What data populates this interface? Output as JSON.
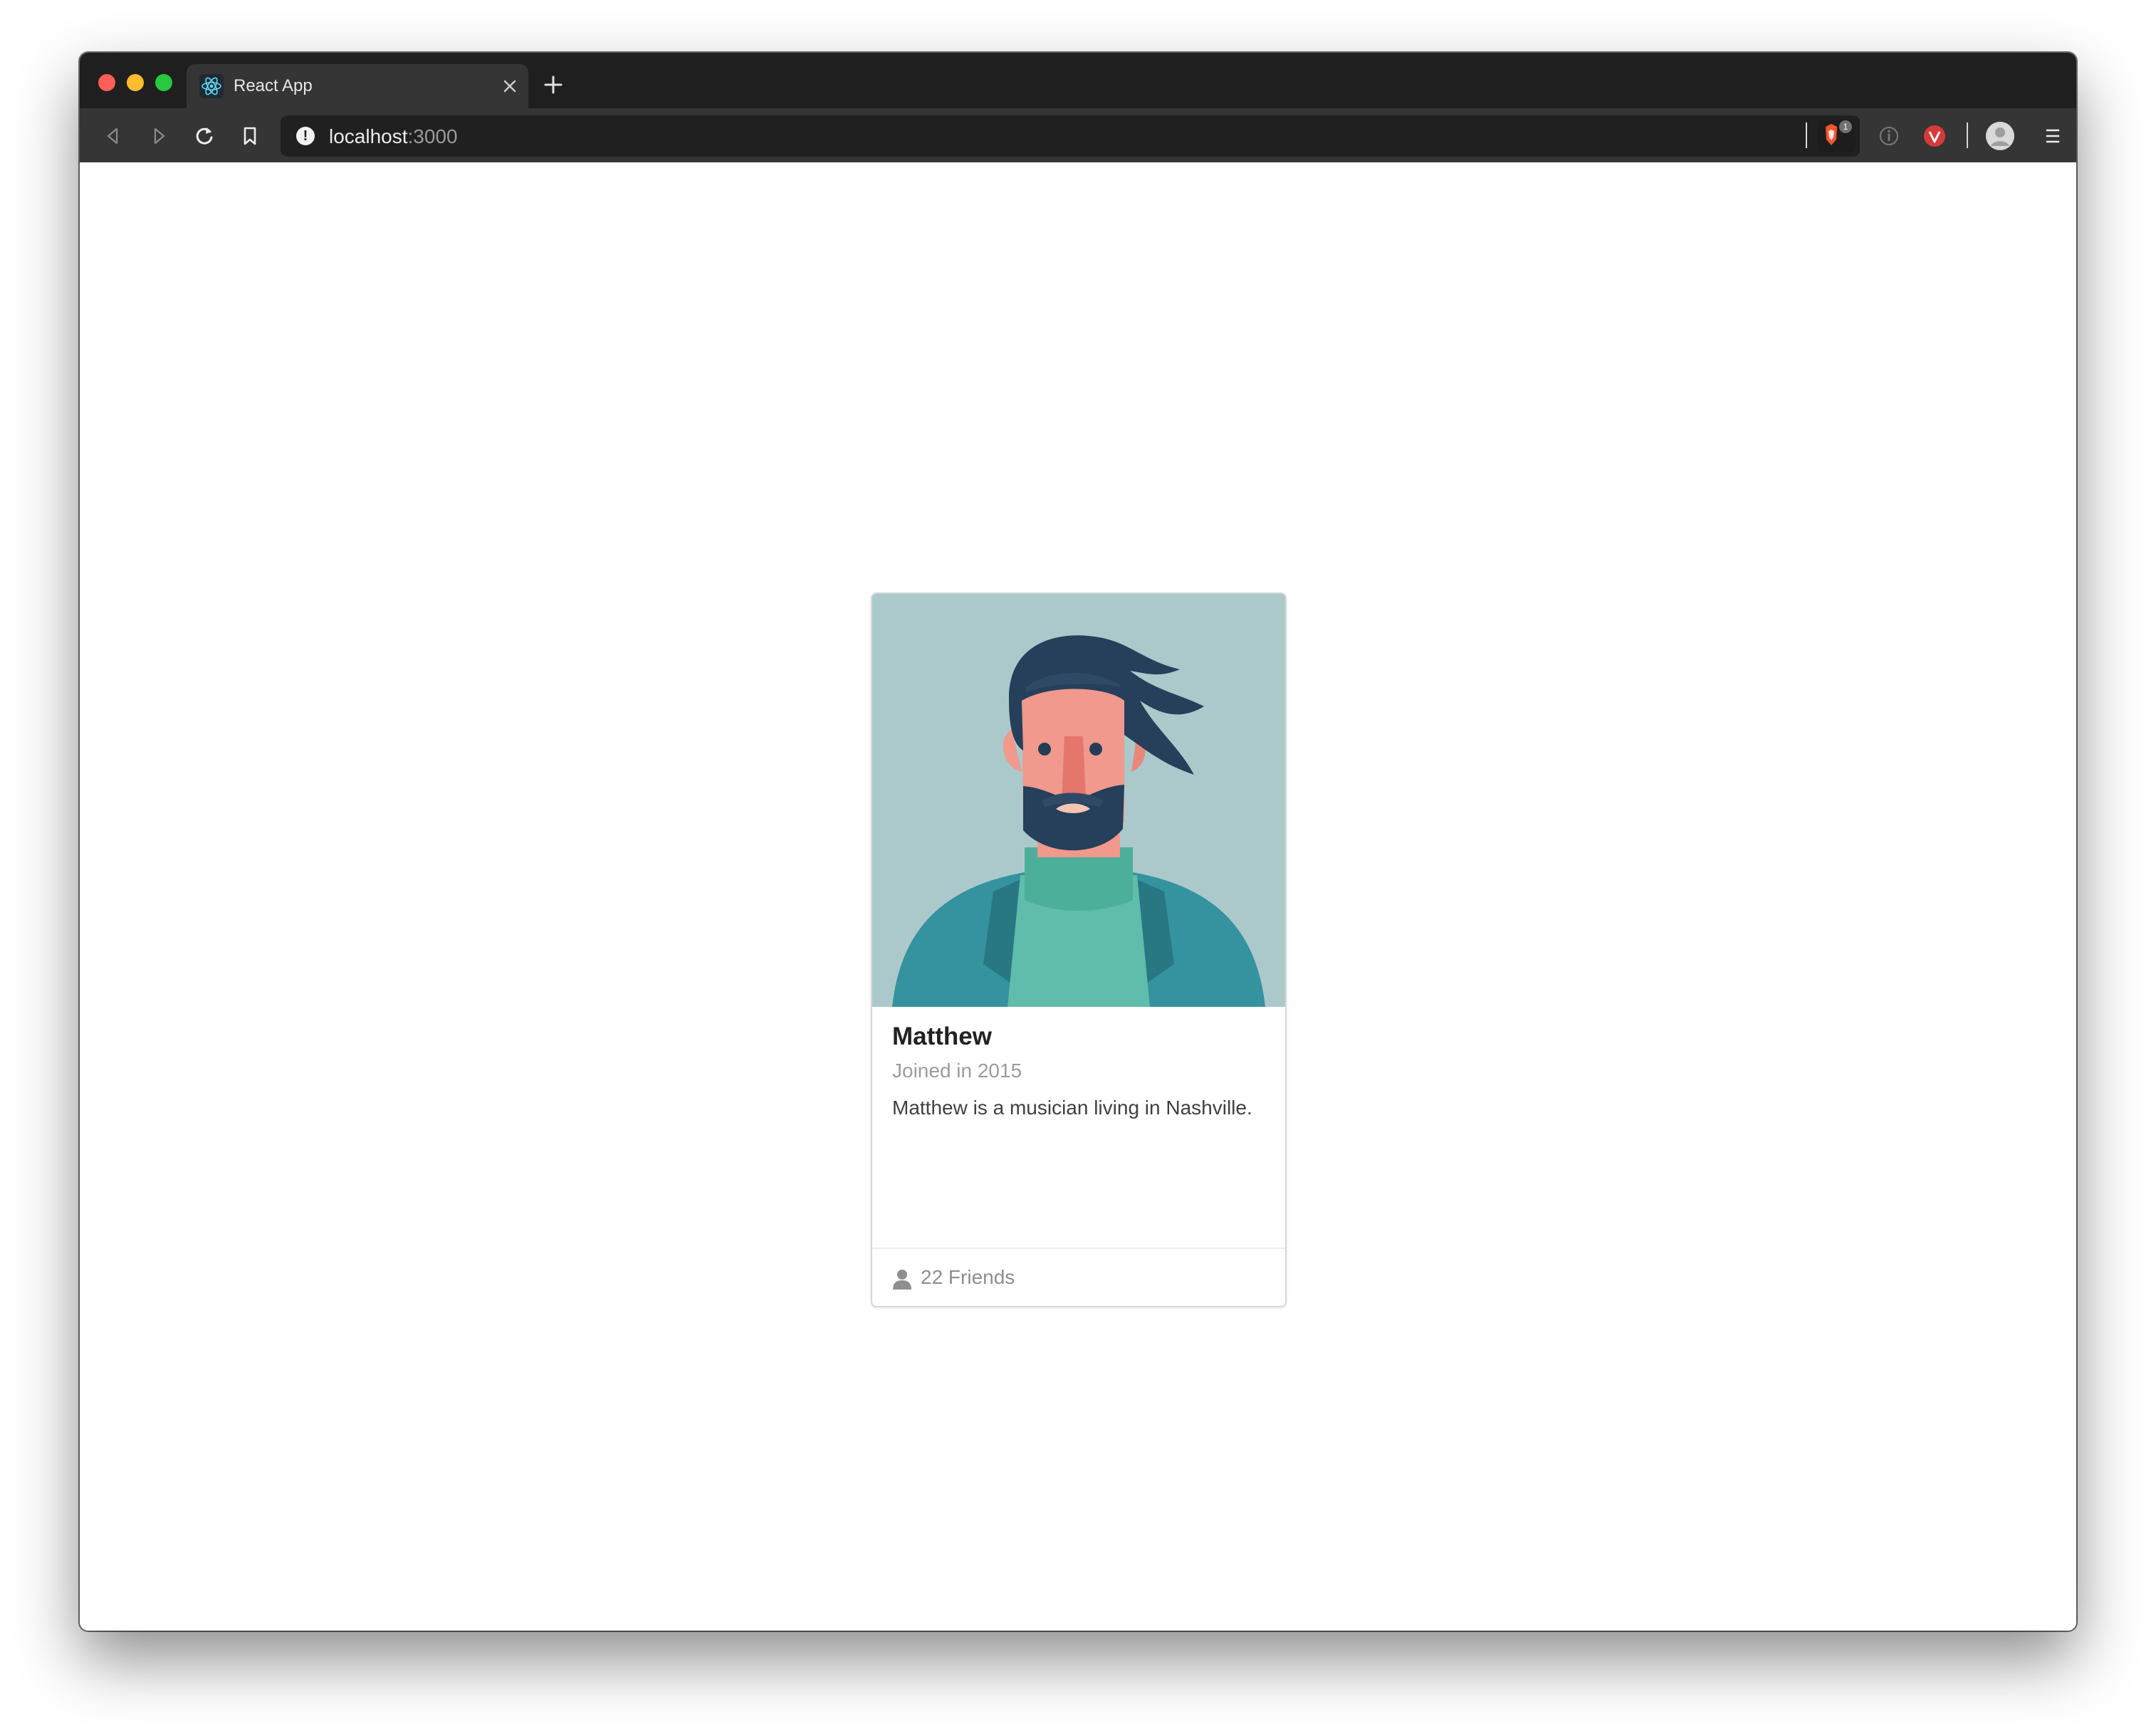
{
  "browser": {
    "tab": {
      "title": "React App",
      "favicon": "react-atom-icon"
    },
    "address": {
      "host": "localhost",
      "port": ":3000"
    },
    "extensions": {
      "shields_count": "1"
    }
  },
  "card": {
    "name": "Matthew",
    "meta": "Joined in 2015",
    "description": "Matthew is a musician living in Nashville.",
    "friends": "22 Friends",
    "friends_icon": "user-icon"
  }
}
